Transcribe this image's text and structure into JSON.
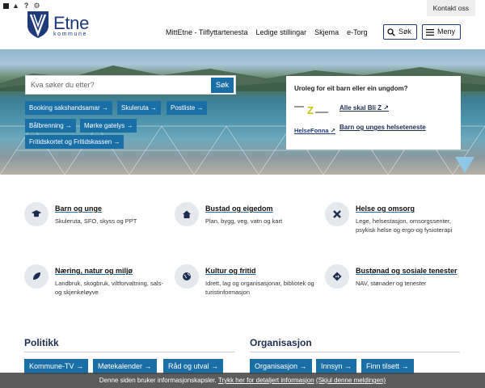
{
  "utility": {
    "contact_label": "Kontakt oss",
    "icons": [
      "square-icon",
      "accessibility-icon",
      "help-icon",
      "settings-icon"
    ]
  },
  "brand": {
    "name": "Etne",
    "subtitle": "kommune"
  },
  "nav": {
    "items": [
      "MittEtne - Tilflyttartenesta",
      "Ledige stillingar",
      "Skjema",
      "e-Torg"
    ],
    "search_label": "Søk",
    "menu_label": "Meny"
  },
  "hero": {
    "search_placeholder": "Kva søker du etter?",
    "search_button": "Søk",
    "quick_links": [
      "Booking sakshandsamar →",
      "Skuleruta →",
      "Postliste →",
      "Bålbrenning →",
      "Mørke gatelys →",
      "Fritidskortet og Fritidskassen →"
    ],
    "panel": {
      "title": "Uroleg for eit barn eller ein ungdom?",
      "link1": "Alle skal Bli Z",
      "link2": "Barn og unges helseteneste",
      "helsefonna": "HelseFonna"
    }
  },
  "services": [
    {
      "title": "Barn og unge",
      "desc": "Skuleruta, SFO, skyss og PPT",
      "icon": "graduation-cap-icon"
    },
    {
      "title": "Bustad og eigedom",
      "desc": "Plan, bygg, veg, vatn og kart",
      "icon": "house-icon"
    },
    {
      "title": "Helse og omsorg",
      "desc": "Lege, helsestasjon, omsorgssenter, psykisk helse og ergo-og fysioterapi",
      "icon": "medical-icon"
    },
    {
      "title": "Næring, natur og miljø",
      "desc": "Landbruk, skogbruk, viltforvaltning, sals-og skjenkeløyve",
      "icon": "leaf-icon"
    },
    {
      "title": "Kultur og fritid",
      "desc": "Idrett, lag og organisasjonar, bibliotek og turistinformasjon",
      "icon": "globe-icon"
    },
    {
      "title": "Bustønad og sosiale tenester",
      "desc": "NAV, stønader og tenester",
      "icon": "direction-icon"
    }
  ],
  "politikk": {
    "title": "Politikk",
    "buttons": [
      "Kommune-TV →",
      "Møtekalender →",
      "Råd og utval →"
    ]
  },
  "organisasjon": {
    "title": "Organisasjon",
    "buttons": [
      "Organisasjon →",
      "Innsyn →",
      "Finn tilsett →"
    ]
  },
  "cookie": {
    "text": "Denne siden bruker informasjonskapsler.",
    "link1": "Trykk her for detaljert informasjon",
    "link2": "(Skjul denne meldingen)"
  },
  "colors": {
    "primary": "#1b6fa7",
    "brand": "#1d3a7a",
    "panel_accent": "#8ec8e6"
  }
}
